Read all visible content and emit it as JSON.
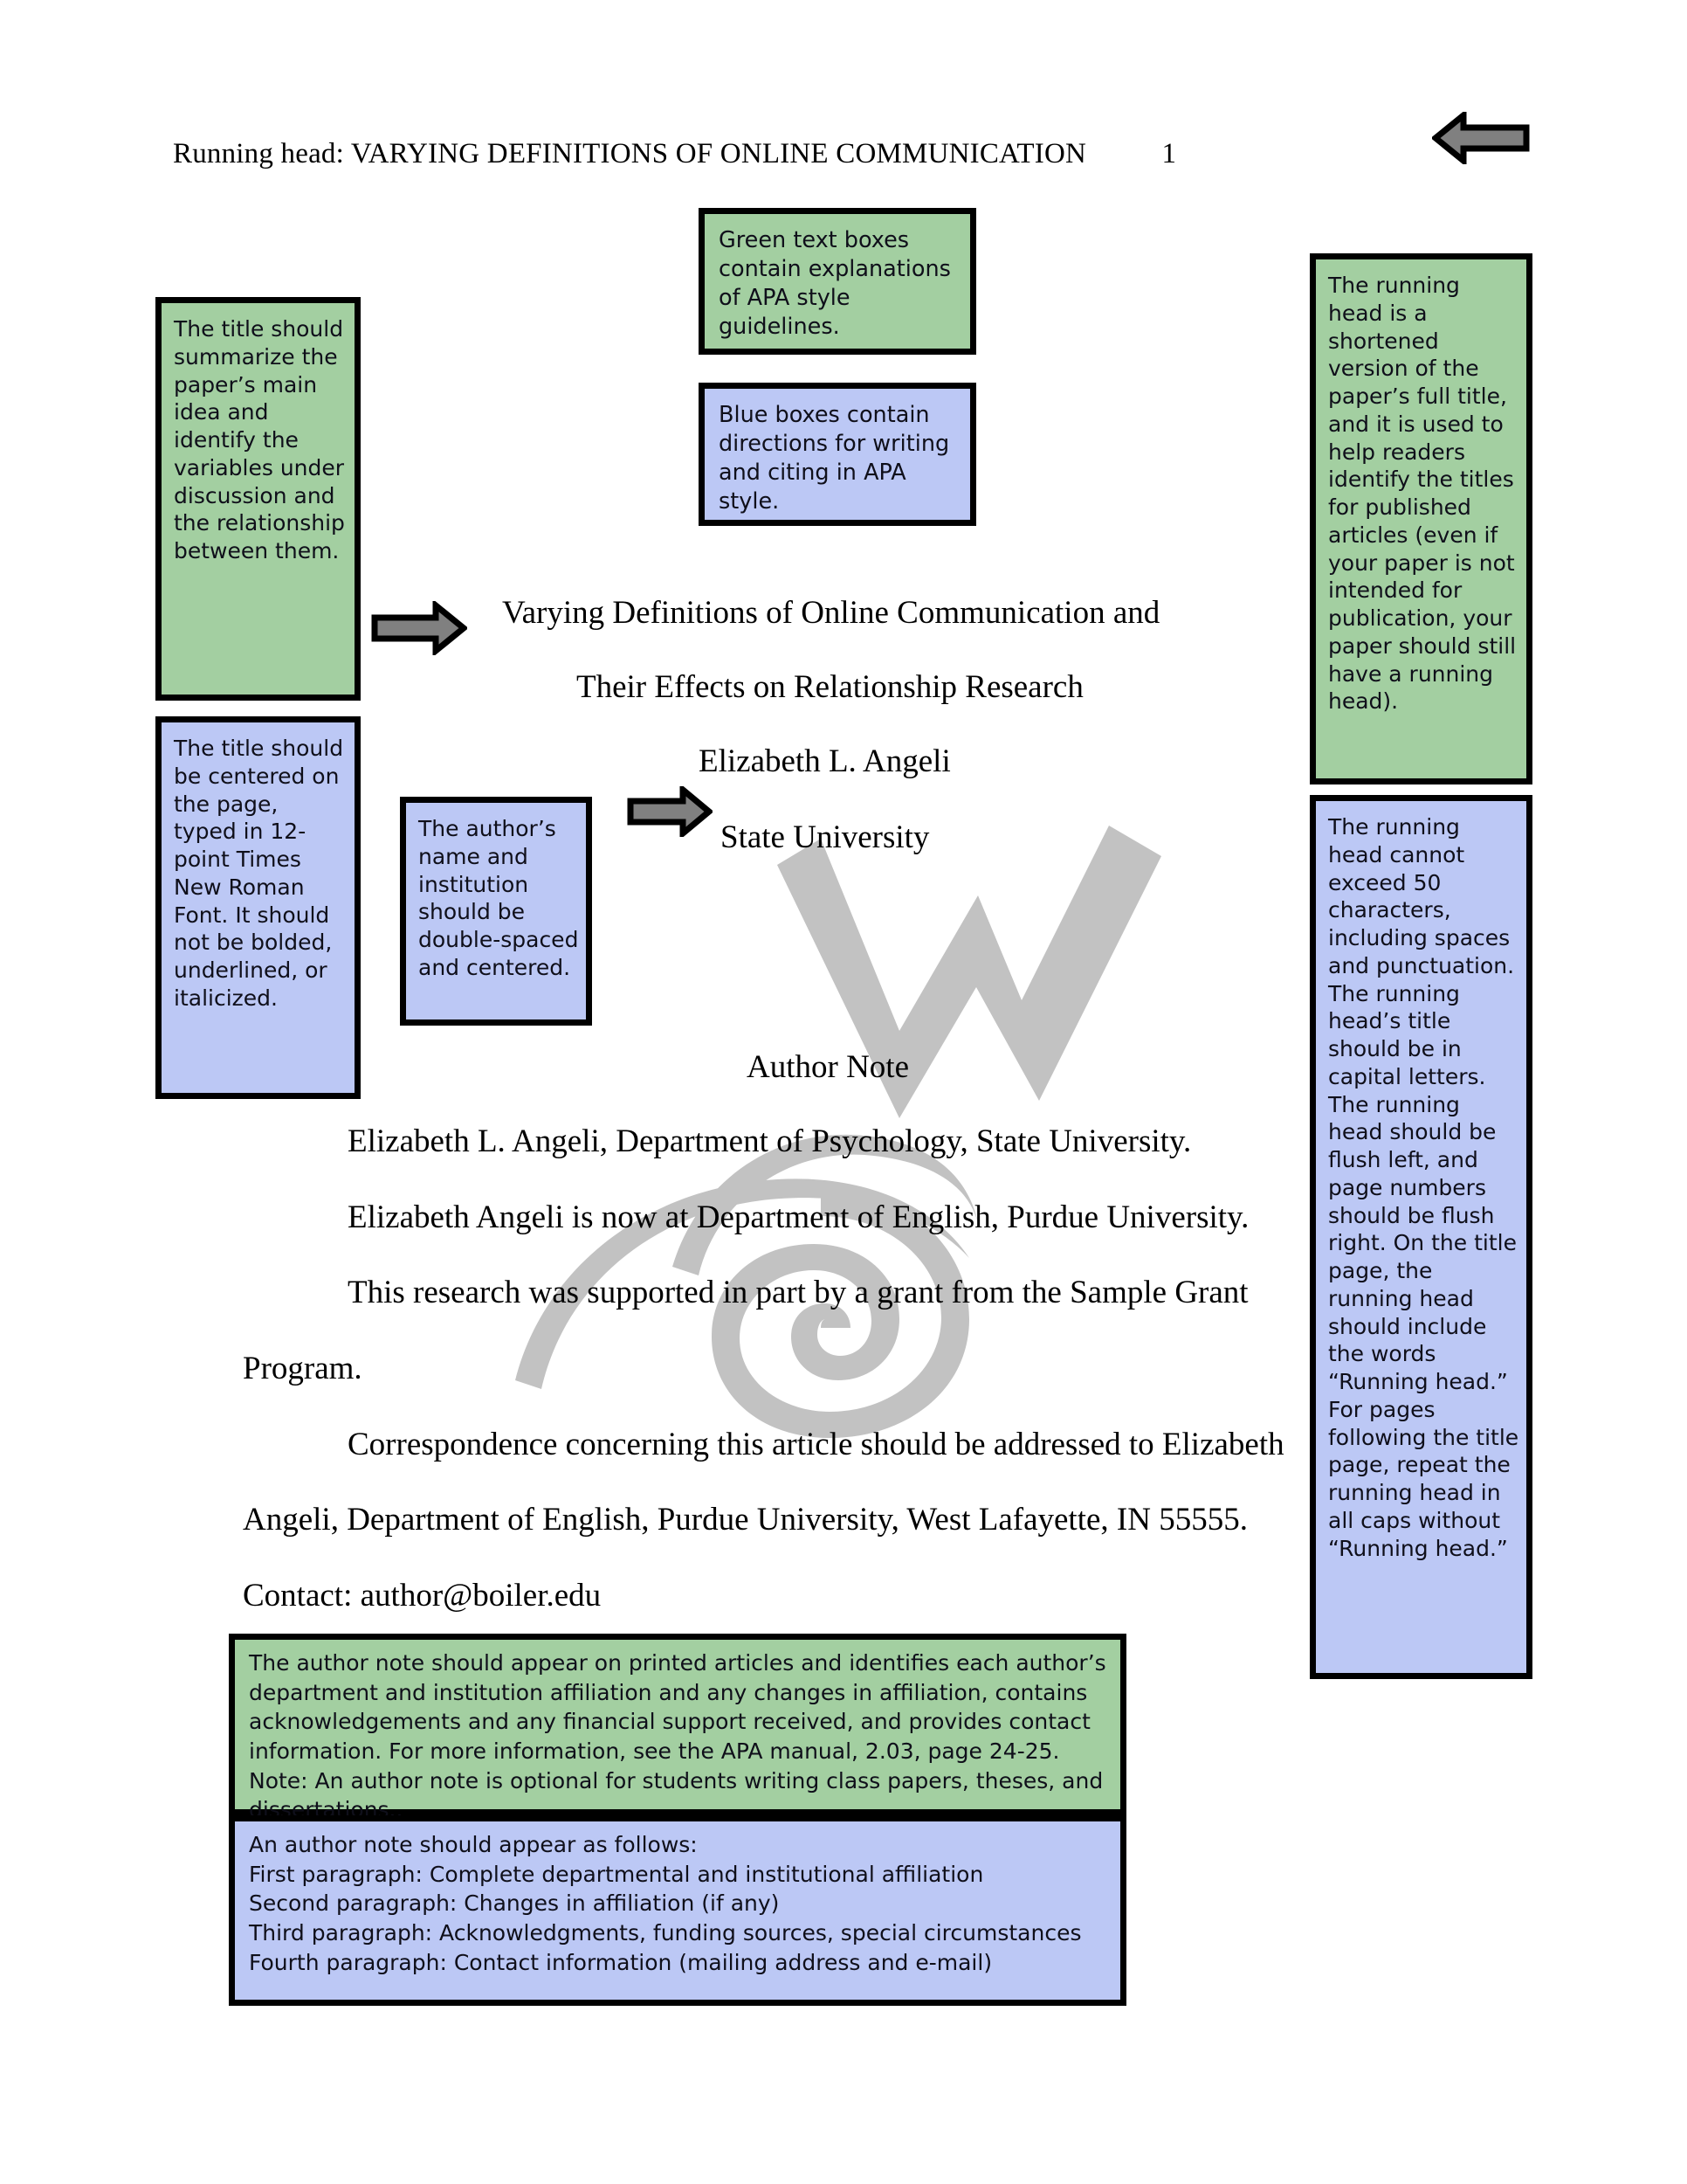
{
  "document": {
    "running_head": {
      "label": "Running head:",
      "title": "VARYING DEFINITIONS OF ONLINE COMMUNICATION",
      "page_number": "1"
    },
    "paper_title_line1": "Varying Definitions of Online Communication and",
    "paper_title_line2": "Their Effects on Relationship Research",
    "author": "Elizabeth L. Angeli",
    "institution": "State University",
    "author_note": {
      "heading": "Author Note",
      "paragraph1": "Elizabeth L. Angeli, Department of Psychology, State University.",
      "paragraph2": "Elizabeth Angeli is now at Department of English, Purdue University.",
      "paragraph3_line1": "This research was supported in part by a grant from the Sample Grant",
      "paragraph3_line2": "Program.",
      "paragraph4_line1": "Correspondence concerning this article should be addressed to Elizabeth",
      "paragraph4_line2": "Angeli, Department of English, Purdue University, West Lafayette, IN 55555.",
      "contact": "Contact: author@boiler.edu"
    }
  },
  "annotations": {
    "legend_green": "Green text boxes contain explanations of APA style guidelines.",
    "legend_blue": "Blue boxes contain directions for writing and citing in APA style.",
    "title_summary": "The title should summarize the paper’s main idea and identify the variables under discussion and the relationship between them.",
    "title_format": "The title should be centered on the page, typed in 12-point Times New Roman Font.  It should not be bolded, underlined, or italicized.",
    "author_name_format": "The author’s name and institution should be double-spaced and centered.",
    "running_head_explain": "The running head is a shortened version of the paper’s full title, and it is used to help readers identify the titles for published articles (even if your paper is not intended for publication, your paper should still have a running head).",
    "running_head_rules": "The running head cannot exceed 50 characters, including spaces and punctuation.  The running head’s title should be in capital letters.  The running head should be flush left, and page numbers should be flush right.  On the title page, the running head should include the words “Running head.”  For pages following the title page, repeat the running head in all caps without “Running head.”",
    "author_note_explain": "The author note should appear on printed articles and identifies each author’s department and institution affiliation and any changes in affiliation, contains acknowledgements and any financial support received, and provides contact information.  For more information, see the APA manual, 2.03, page 24-25.\nNote: An author note is optional for students writing class papers, theses, and dissertations..",
    "author_note_structure": "An author note should appear as follows:\nFirst paragraph: Complete departmental and institutional affiliation\nSecond paragraph: Changes in affiliation (if any)\nThird paragraph: Acknowledgments, funding sources, special circumstances\nFourth paragraph: Contact information (mailing address and e-mail)"
  },
  "watermark": {
    "text": "OWL"
  },
  "colors": {
    "green_box": "#a3cfa1",
    "blue_box": "#bcc8f5",
    "box_border": "#000000",
    "arrow_fill": "#808080",
    "arrow_outline": "#000000",
    "watermark": "#c0c0c0",
    "page_background": "#ffffff",
    "body_text": "#000000"
  }
}
